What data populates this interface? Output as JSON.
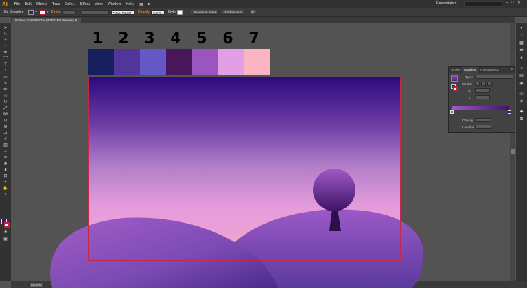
{
  "app": {
    "logo": "Ai",
    "workspace": "Essentials"
  },
  "menu": [
    "File",
    "Edit",
    "Object",
    "Type",
    "Select",
    "Effect",
    "View",
    "Window",
    "Help"
  ],
  "control": {
    "selection": "No Selection",
    "stroke_label": "Stroke",
    "brush": "3 pt. Round",
    "opacity_label": "Opacity",
    "opacity_value": "100%",
    "style_label": "Style",
    "doc_setup": "Document Setup",
    "preferences": "Preferences"
  },
  "document": {
    "tab": "Untitled-1* @ 66.67% (RGB/GPU Preview)"
  },
  "swatches": [
    {
      "number": "1",
      "color": "#16205f"
    },
    {
      "number": "2",
      "color": "#52359a"
    },
    {
      "number": "3",
      "color": "#6457c6"
    },
    {
      "number": "4",
      "color": "#47175a"
    },
    {
      "number": "5",
      "color": "#9b55c1"
    },
    {
      "number": "6",
      "color": "#e39fe6"
    },
    {
      "number": "7",
      "color": "#fbb4c4"
    }
  ],
  "gradient_panel": {
    "tabs": [
      "Stroke",
      "Gradient",
      "Transparency"
    ],
    "type_label": "Type:",
    "stroke_label": "Stroke:",
    "opacity_label": "Opacity:",
    "location_label": "Location:"
  },
  "status": {
    "zoom": "66.67%",
    "page": "1",
    "tool": "Selection"
  },
  "colors": {
    "accent": "#ff9a00",
    "artboard_border": "#c12a4a",
    "sky_top": "#2c0a7d",
    "sky_bottom": "#f4a7d0"
  }
}
